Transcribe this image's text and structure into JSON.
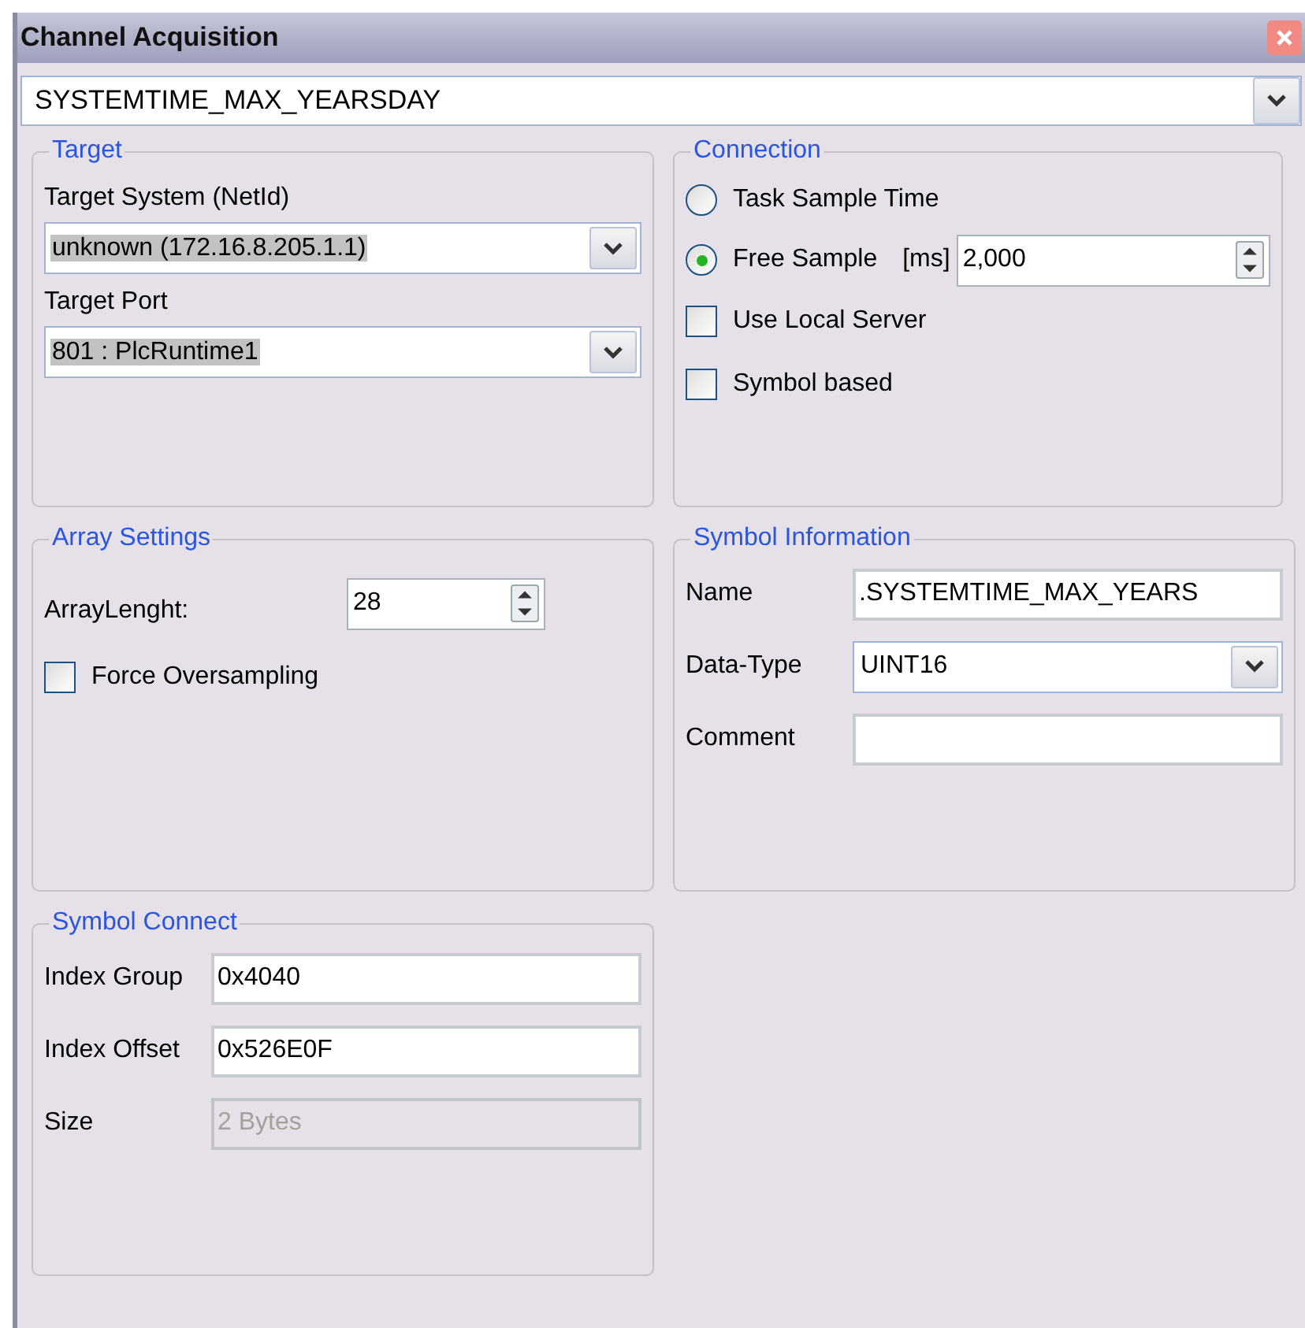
{
  "window": {
    "title": "Channel Acquisition"
  },
  "channel_select": {
    "value": "SYSTEMTIME_MAX_YEARSDAY"
  },
  "groups": [
    {
      "title": "Target",
      "rows": [
        {
          "kind": "label",
          "text": "Target System (NetId)"
        },
        {
          "kind": "combo",
          "value": "unknown (172.16.8.205.1.1)",
          "highlighted": true
        },
        {
          "kind": "label",
          "text": "Target Port"
        },
        {
          "kind": "combo",
          "value": "801 : PlcRuntime1",
          "highlighted": true
        }
      ]
    },
    {
      "title": "Connection",
      "rows": [
        {
          "kind": "radio",
          "label": "Task Sample Time",
          "selected": false
        },
        {
          "kind": "radio",
          "label": "Free Sample",
          "selected": true,
          "unit": "[ms]",
          "value": "2,000"
        },
        {
          "kind": "checkbox",
          "label": "Use Local Server",
          "checked": false
        },
        {
          "kind": "checkbox",
          "label": "Symbol based",
          "checked": false
        }
      ]
    },
    {
      "title": "Array Settings",
      "rows": [
        {
          "kind": "spin",
          "label": "ArrayLenght:",
          "value": "28"
        },
        {
          "kind": "checkbox",
          "label": "Force Oversampling",
          "checked": false
        }
      ]
    },
    {
      "title": "Symbol Information",
      "rows": [
        {
          "kind": "field",
          "label": "Name",
          "value": ".SYSTEMTIME_MAX_YEARS",
          "disabled": false
        },
        {
          "kind": "labeled-combo",
          "label": "Data-Type",
          "value": "UINT16"
        },
        {
          "kind": "field",
          "label": "Comment",
          "disabled": false
        }
      ]
    },
    {
      "title": "Symbol Connect",
      "rows": [
        {
          "kind": "field",
          "label": "Index Group",
          "value": "0x4040",
          "disabled": false
        },
        {
          "kind": "field",
          "label": "Index Offset",
          "value": "0x526E0F",
          "disabled": false
        },
        {
          "kind": "field",
          "label": "Size",
          "value": "2 Bytes",
          "disabled": true
        }
      ]
    }
  ]
}
